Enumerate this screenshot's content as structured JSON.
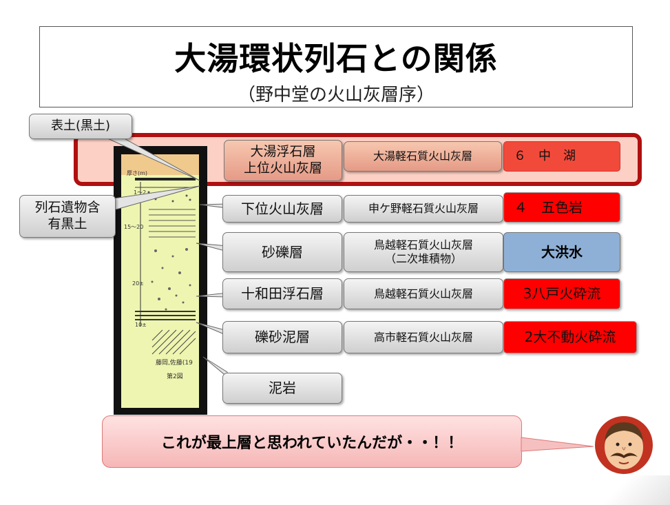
{
  "title": "大湯環状列石との関係",
  "subtitle": "（野中堂の火山灰層序）",
  "left_labels": {
    "topsoil": "表土(黒土)",
    "relic_soil": "列石遺物含\n有黒土"
  },
  "column": {
    "labels": [
      "厚さ(m)",
      "1～2",
      "15～20",
      "20±",
      "10±",
      "藤岡,佐藤(19",
      "第2図"
    ]
  },
  "layers": [
    {
      "name": "大湯浮石層\n上位火山灰層",
      "type": "大湯軽石質火山灰層",
      "event": "６　中　湖"
    },
    {
      "name": "下位火山灰層",
      "type": "申ケ野軽石質火山灰層",
      "event": "４　五色岩"
    },
    {
      "name": "砂礫層",
      "type": "鳥越軽石質火山灰層\n（二次堆積物）",
      "event": "大洪水"
    },
    {
      "name": "十和田浮石層",
      "type": "鳥越軽石質火山灰層",
      "event": "3八戸火砕流"
    },
    {
      "name": "礫砂泥層",
      "type": "高市軽石質火山灰層",
      "event": "2大不動火砕流"
    },
    {
      "name": "泥岩"
    }
  ],
  "speech": "これが最上層と思われていたんだが・・！！",
  "colors": {
    "highlight_border": "#b01010",
    "event_red": "#ff0000",
    "event_blue": "#8fb0d6",
    "column_fill": "#eef5b0"
  }
}
